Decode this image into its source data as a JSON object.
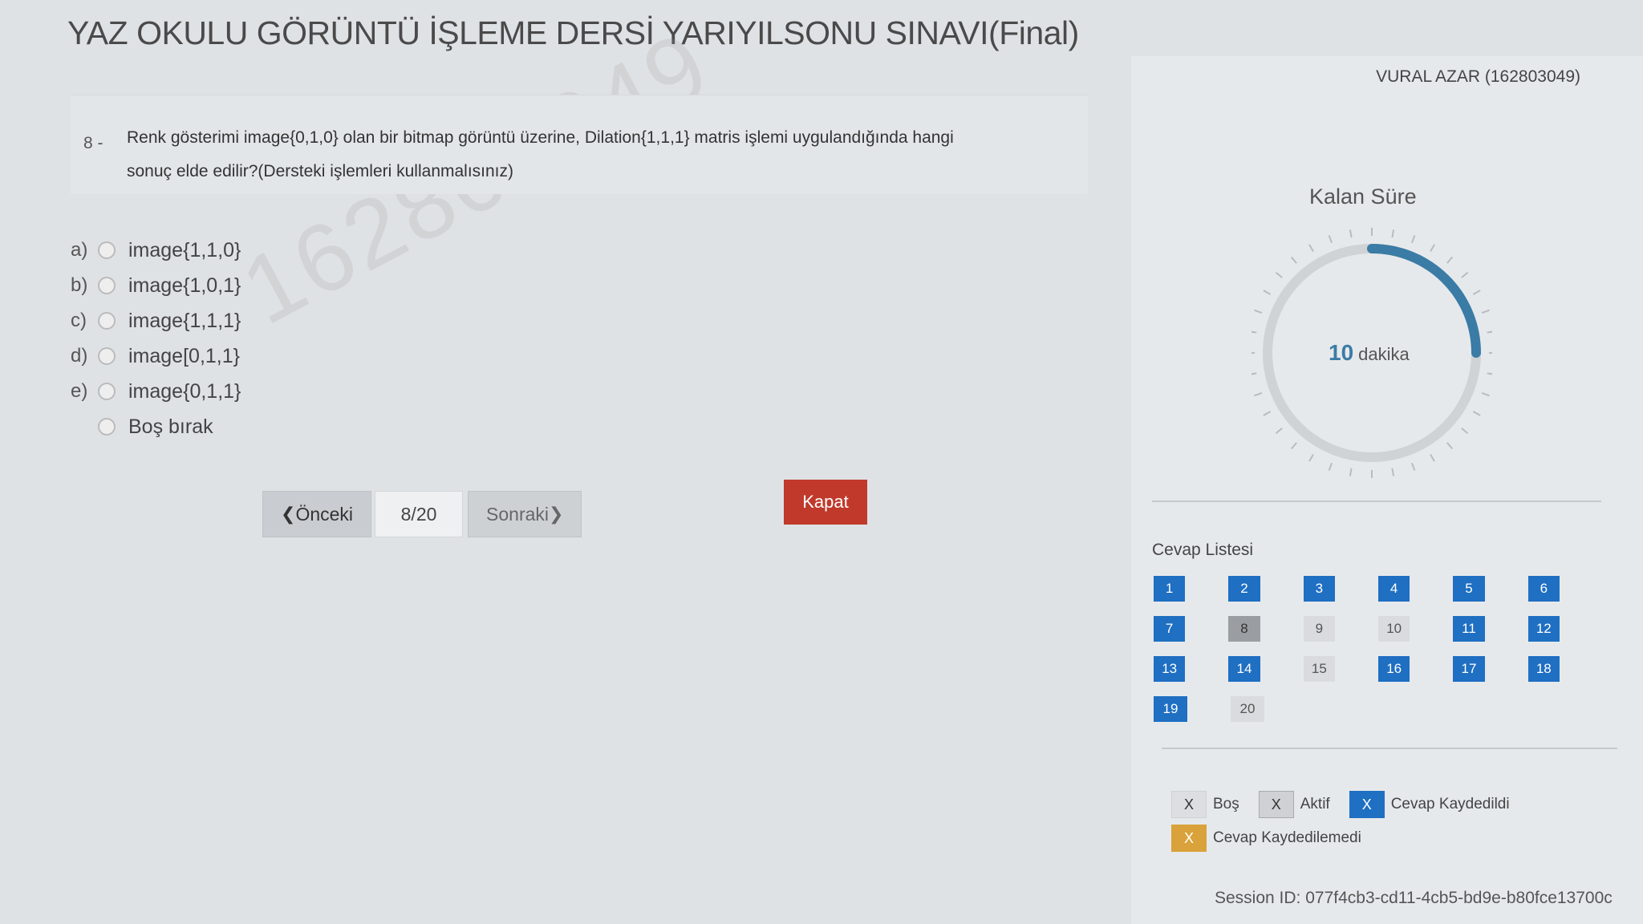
{
  "exam": {
    "title": "YAZ OKULU GÖRÜNTÜ İŞLEME DERSİ YARIYILSONU SINAVI(Final)",
    "student": "VURAL AZAR (162803049)",
    "watermark": "162803049"
  },
  "question": {
    "number": "8 -",
    "text_line1": "Renk gösterimi image{0,1,0} olan bir bitmap görüntü üzerine, Dilation{1,1,1} matris işlemi uygulandığında hangi",
    "text_line2": "sonuç elde edilir?(Dersteki işlemleri kullanmalısınız)"
  },
  "options": [
    {
      "letter": "a)",
      "text": "image{1,1,0}"
    },
    {
      "letter": "b)",
      "text": "image{1,0,1}"
    },
    {
      "letter": "c)",
      "text": "image{1,1,1}"
    },
    {
      "letter": "d)",
      "text": "image[0,1,1}"
    },
    {
      "letter": "e)",
      "text": "image{0,1,1}"
    },
    {
      "letter": "",
      "text": "Boş bırak"
    }
  ],
  "nav": {
    "prev": "Önceki",
    "count": "8/20",
    "next": "Sonraki",
    "close": "Kapat"
  },
  "timer": {
    "label": "Kalan Süre",
    "value": "10",
    "unit": "dakika",
    "progress": 0.25,
    "accent": "#3a7ca5"
  },
  "answers": {
    "title": "Cevap Listesi",
    "rows": [
      [
        {
          "n": "1",
          "s": "saved"
        },
        {
          "n": "2",
          "s": "saved"
        },
        {
          "n": "3",
          "s": "saved"
        },
        {
          "n": "4",
          "s": "saved"
        },
        {
          "n": "5",
          "s": "saved"
        },
        {
          "n": "6",
          "s": "saved"
        }
      ],
      [
        {
          "n": "7",
          "s": "saved"
        },
        {
          "n": "8",
          "s": "active"
        },
        {
          "n": "9",
          "s": "empty"
        },
        {
          "n": "10",
          "s": "empty"
        },
        {
          "n": "11",
          "s": "saved"
        },
        {
          "n": "12",
          "s": "saved"
        }
      ],
      [
        {
          "n": "13",
          "s": "saved"
        },
        {
          "n": "14",
          "s": "saved"
        },
        {
          "n": "15",
          "s": "empty"
        },
        {
          "n": "16",
          "s": "saved"
        },
        {
          "n": "17",
          "s": "saved"
        },
        {
          "n": "18",
          "s": "saved"
        }
      ],
      [
        {
          "n": "19",
          "s": "saved"
        },
        {
          "n": "20",
          "s": "empty"
        }
      ]
    ]
  },
  "legend": {
    "mark": "X",
    "empty": "Boş",
    "active": "Aktif",
    "saved": "Cevap Kaydedildi",
    "not_saved": "Cevap Kaydedilemedi"
  },
  "session": "Session ID: 077f4cb3-cd11-4cb5-bd9e-b80fce13700c"
}
